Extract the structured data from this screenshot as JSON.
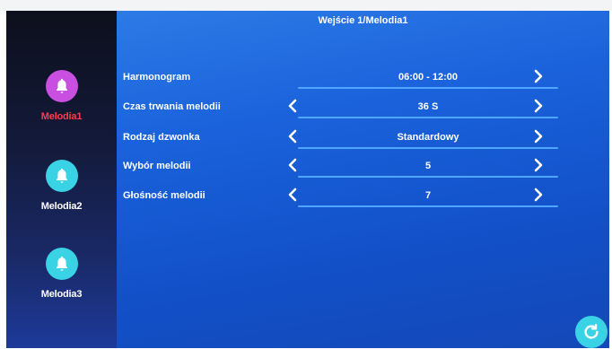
{
  "title": "Wejście 1/Melodia1",
  "sidebar": {
    "items": [
      {
        "label": "Melodia1",
        "active": true
      },
      {
        "label": "Melodia2",
        "active": false
      },
      {
        "label": "Melodia3",
        "active": false
      }
    ]
  },
  "settings": [
    {
      "label": "Harmonogram",
      "value": "06:00 - 12:00",
      "has_left_arrow": false
    },
    {
      "label": "Czas trwania melodii",
      "value": "36 S",
      "has_left_arrow": true
    },
    {
      "label": "Rodzaj dzwonka",
      "value": "Standardowy",
      "has_left_arrow": true
    },
    {
      "label": "Wybór melodii",
      "value": "5",
      "has_left_arrow": true
    },
    {
      "label": "Głośność melodii",
      "value": "7",
      "has_left_arrow": true
    }
  ],
  "colors": {
    "active_accent": "#ff3b4e",
    "active_icon_bg": "#c94fe0",
    "inactive_icon_bg": "#3ad3e6",
    "divider": "#4fa6ff"
  },
  "icons": {
    "sidebar": "bell-icon",
    "left": "chevron-left-icon",
    "right": "chevron-right-icon",
    "corner": "refresh-icon"
  }
}
